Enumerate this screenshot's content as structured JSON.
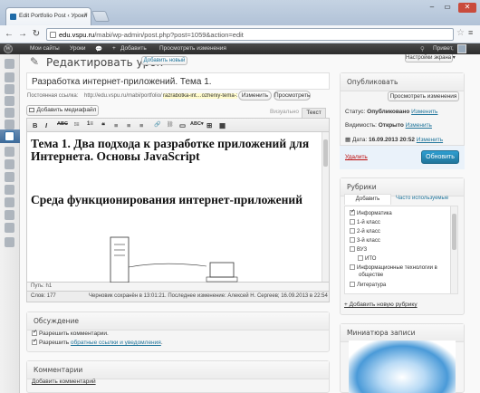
{
  "browser": {
    "tab_title": "Edit Portfolio Post ‹ Уроки",
    "url_lead": "edu.vspu.ru",
    "url_rest": "/mabi/wp-admin/post.php?post=1059&action=edit"
  },
  "adminbar": {
    "site_name": "Мои сайты",
    "section": "Уроки",
    "add_label": "Добавить",
    "preview_label": "Просмотреть изменения",
    "greeting": "Привет,"
  },
  "page": {
    "heading": "Редактировать урок",
    "add_new": "Добавить новый",
    "screen_options": "Настройки экрана ▾"
  },
  "editor": {
    "title_value": "Разработка интернет-приложений. Тема 1.",
    "permalink_label": "Постоянная ссылка:",
    "permalink_base": "http://edu.vspu.ru/mabi/portfolio/",
    "permalink_slug": "razrabotka-int…ozheniy-tema-1/",
    "edit_slug_btn": "Изменить",
    "view_post_btn": "Просмотреть",
    "add_media_btn": "Добавить медиафайл",
    "tab_visual": "Визуально",
    "tab_text": "Текст",
    "content_h1a": "Тема 1. Два подхода к разработке приложений для Интернета. Основы JavaScript",
    "content_h1b": "Среда функционирования интернет-приложений",
    "path": "Путь: h1",
    "wordcount": "Слов: 177",
    "autosave": "Черновик сохранён в 13:01:21. Последнее изменение: Алексей Н. Сергеев; 16.09.2013 в 22:54"
  },
  "discussion": {
    "title": "Обсуждение",
    "allow_comments": "Разрешить комментарии.",
    "allow_pings_prefix": "Разрешить",
    "allow_pings_link": "обратные ссылки и уведомления",
    "allow_pings_suffix": "."
  },
  "comments": {
    "title": "Комментарии",
    "add_link": "Добавить комментарий"
  },
  "publish": {
    "title": "Опубликовать",
    "preview_btn": "Просмотреть изменения",
    "status_label": "Статус:",
    "status_value": "Опубликовано",
    "status_edit": "Изменить",
    "visibility_label": "Видимость:",
    "visibility_value": "Открыто",
    "visibility_edit": "Изменить",
    "date_label": "Дата:",
    "date_value": "16.09.2013 20:52",
    "date_edit": "Изменить",
    "trash_link": "Удалить",
    "update_btn": "Обновить"
  },
  "categories": {
    "title": "Рубрики",
    "tab_all": "Добавить рубрику",
    "tab_popular": "Часто используемые",
    "items": [
      {
        "label": "Информатика",
        "checked": true
      },
      {
        "label": "1-й класс",
        "checked": false
      },
      {
        "label": "2-й класс",
        "checked": false
      },
      {
        "label": "3-й класс",
        "checked": false
      },
      {
        "label": "ВУЗ",
        "checked": false
      },
      {
        "label": "ИТО",
        "checked": false
      },
      {
        "label": "Информационные технологии в",
        "checked": false
      },
      {
        "label": "обществе",
        "checked": false
      },
      {
        "label": "Литература",
        "checked": false
      }
    ],
    "add_new_link": "+ Добавить новую рубрику"
  },
  "thumbnail": {
    "title": "Миниатюра записи"
  },
  "toolbar_buttons": [
    "B",
    "I",
    "ABC",
    "⁝≡",
    "1≡",
    "❝",
    "≡",
    "≡",
    "≡",
    "🔗",
    "⛓",
    "▭",
    "ABC▾",
    "⊞",
    "▦"
  ]
}
